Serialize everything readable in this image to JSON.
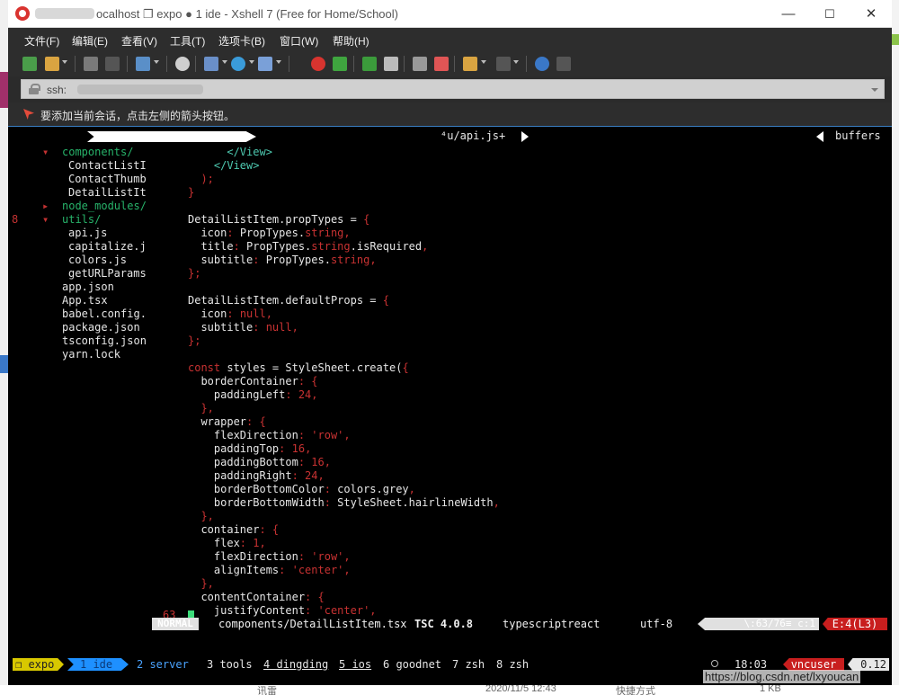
{
  "window": {
    "title": "ocalhost ❐ expo ● 1 ide - Xshell 7 (Free for Home/School)",
    "controls": [
      "—",
      "☐",
      "✕"
    ]
  },
  "menu": [
    "文件(F)",
    "编辑(E)",
    "查看(V)",
    "工具(T)",
    "选项卡(B)",
    "窗口(W)",
    "帮助(H)"
  ],
  "address": {
    "value": "ssh:"
  },
  "hint": {
    "text": "要添加当前会话，点击左侧的箭头按钮。"
  },
  "colors": {
    "accent": "#3a7fc4",
    "error": "#c81e1e",
    "session": "#d8c800",
    "active_window": "#1e90ff"
  },
  "vim": {
    "top_tab_file": "⁴u/api.js+",
    "top_tab_right": "buffers",
    "tree": [
      {
        "mark": "▾",
        "text": "components/",
        "kind": "dir"
      },
      {
        "mark": "",
        "text": "ContactListI",
        "kind": "file1"
      },
      {
        "mark": "",
        "text": "ContactThumb",
        "kind": "file1"
      },
      {
        "mark": "",
        "text": "DetailListIt",
        "kind": "file1"
      },
      {
        "mark": "▸",
        "text": "node_modules/",
        "kind": "dir"
      },
      {
        "mark": "▾",
        "text": "utils/",
        "kind": "dir",
        "num": "8"
      },
      {
        "mark": "",
        "text": "api.js",
        "kind": "file1"
      },
      {
        "mark": "",
        "text": "capitalize.j",
        "kind": "file1"
      },
      {
        "mark": "",
        "text": "colors.js",
        "kind": "file1"
      },
      {
        "mark": "",
        "text": "getURLParams",
        "kind": "file1"
      },
      {
        "mark": "",
        "text": "app.json",
        "kind": "file0"
      },
      {
        "mark": "",
        "text": "App.tsx",
        "kind": "file0"
      },
      {
        "mark": "",
        "text": "babel.config.",
        "kind": "file0"
      },
      {
        "mark": "",
        "text": "package.json",
        "kind": "file0"
      },
      {
        "mark": "",
        "text": "tsconfig.json",
        "kind": "file0"
      },
      {
        "mark": "",
        "text": "yarn.lock",
        "kind": "file0"
      }
    ],
    "code": [
      [
        [
          "tag",
          "      </View>"
        ]
      ],
      [
        [
          "tag",
          "    </View>"
        ]
      ],
      [
        [
          "punct",
          "  );"
        ]
      ],
      [
        [
          "punct",
          "}"
        ]
      ],
      [],
      [
        [
          "code",
          "DetailListItem.propTypes "
        ],
        [
          "code",
          "= "
        ],
        [
          "punct",
          "{"
        ]
      ],
      [
        [
          "code",
          "  icon"
        ],
        [
          "punct",
          ": "
        ],
        [
          "code",
          "PropTypes."
        ],
        [
          "str",
          "string"
        ],
        [
          "punct",
          ","
        ]
      ],
      [
        [
          "code",
          "  title"
        ],
        [
          "punct",
          ": "
        ],
        [
          "code",
          "PropTypes."
        ],
        [
          "str",
          "string"
        ],
        [
          "code",
          ".isRequired"
        ],
        [
          "punct",
          ","
        ]
      ],
      [
        [
          "code",
          "  subtitle"
        ],
        [
          "punct",
          ": "
        ],
        [
          "code",
          "PropTypes."
        ],
        [
          "str",
          "string"
        ],
        [
          "punct",
          ","
        ]
      ],
      [
        [
          "punct",
          "};"
        ]
      ],
      [],
      [
        [
          "code",
          "DetailListItem.defaultProps "
        ],
        [
          "code",
          "= "
        ],
        [
          "punct",
          "{"
        ]
      ],
      [
        [
          "code",
          "  icon"
        ],
        [
          "punct",
          ": "
        ],
        [
          "kw",
          "null"
        ],
        [
          "punct",
          ","
        ]
      ],
      [
        [
          "code",
          "  subtitle"
        ],
        [
          "punct",
          ": "
        ],
        [
          "kw",
          "null"
        ],
        [
          "punct",
          ","
        ]
      ],
      [
        [
          "punct",
          "};"
        ]
      ],
      [],
      [
        [
          "kw",
          "const "
        ],
        [
          "code",
          "styles = StyleSheet.create("
        ],
        [
          "punct",
          "{"
        ]
      ],
      [
        [
          "code",
          "  borderContainer"
        ],
        [
          "punct",
          ": {"
        ]
      ],
      [
        [
          "code",
          "    paddingLeft"
        ],
        [
          "punct",
          ": "
        ],
        [
          "nm",
          "24"
        ],
        [
          "punct",
          ","
        ]
      ],
      [
        [
          "punct",
          "  },"
        ]
      ],
      [
        [
          "code",
          "  wrapper"
        ],
        [
          "punct",
          ": {"
        ]
      ],
      [
        [
          "code",
          "    flexDirection"
        ],
        [
          "punct",
          ": "
        ],
        [
          "str",
          "'row'"
        ],
        [
          "punct",
          ","
        ]
      ],
      [
        [
          "code",
          "    paddingTop"
        ],
        [
          "punct",
          ": "
        ],
        [
          "nm",
          "16"
        ],
        [
          "punct",
          ","
        ]
      ],
      [
        [
          "code",
          "    paddingBottom"
        ],
        [
          "punct",
          ": "
        ],
        [
          "nm",
          "16"
        ],
        [
          "punct",
          ","
        ]
      ],
      [
        [
          "code",
          "    paddingRight"
        ],
        [
          "punct",
          ": "
        ],
        [
          "nm",
          "24"
        ],
        [
          "punct",
          ","
        ]
      ],
      [
        [
          "code",
          "    borderBottomColor"
        ],
        [
          "punct",
          ": "
        ],
        [
          "code",
          "colors.grey"
        ],
        [
          "punct",
          ","
        ]
      ],
      [
        [
          "code",
          "    borderBottomWidth"
        ],
        [
          "punct",
          ": "
        ],
        [
          "code",
          "StyleSheet.hairlineWidth"
        ],
        [
          "punct",
          ","
        ]
      ],
      [
        [
          "punct",
          "  },"
        ]
      ],
      [
        [
          "code",
          "  container"
        ],
        [
          "punct",
          ": {"
        ]
      ],
      [
        [
          "code",
          "    flex"
        ],
        [
          "punct",
          ": "
        ],
        [
          "nm",
          "1"
        ],
        [
          "punct",
          ","
        ]
      ],
      [
        [
          "code",
          "    flexDirection"
        ],
        [
          "punct",
          ": "
        ],
        [
          "str",
          "'row'"
        ],
        [
          "punct",
          ","
        ]
      ],
      [
        [
          "code",
          "    alignItems"
        ],
        [
          "punct",
          ": "
        ],
        [
          "str",
          "'center'"
        ],
        [
          "punct",
          ","
        ]
      ],
      [
        [
          "punct",
          "  },"
        ]
      ],
      [
        [
          "code",
          "  contentContainer"
        ],
        [
          "punct",
          ": {"
        ]
      ],
      [
        [
          "code",
          "    justifyContent"
        ],
        [
          "punct",
          ": "
        ],
        [
          "str",
          "'center'"
        ],
        [
          "punct",
          ","
        ]
      ]
    ],
    "current_line": "63",
    "status": {
      "mode": "NORMAL",
      "file": "components/DetailListItem.tsx",
      "tsc": "TSC 4.0.8",
      "filetype": "typescriptreact",
      "encoding": "utf-8",
      "position": "\\:63/76≡ c:1",
      "error": "E:4(L3)"
    }
  },
  "tmux": {
    "session": "❐ expo",
    "active": "1 ide",
    "windows": [
      {
        "label": "2 server",
        "style": "blue"
      },
      {
        "label": "3 tools",
        "style": ""
      },
      {
        "label": "4 dingding",
        "style": "u"
      },
      {
        "label": "5 ios",
        "style": "u"
      },
      {
        "label": "6 goodnet",
        "style": ""
      },
      {
        "label": "7 zsh",
        "style": ""
      },
      {
        "label": "8 zsh",
        "style": ""
      }
    ],
    "time": "18:03",
    "user": "vncuser",
    "load": "0.12"
  },
  "watermark": "https://blog.csdn.net/lxyoucan",
  "bottom_strip": [
    "讯雷",
    "2020/11/5 12:43",
    "快捷方式",
    "1 KB"
  ]
}
